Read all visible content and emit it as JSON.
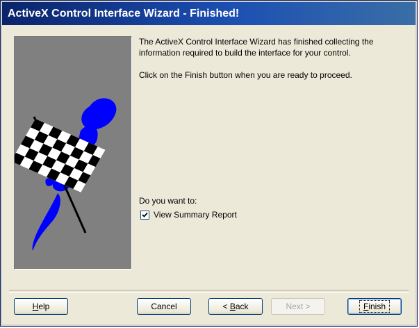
{
  "window": {
    "title": "ActiveX Control Interface Wizard - Finished!"
  },
  "content": {
    "paragraph1": "The ActiveX Control Interface Wizard has finished collecting the information required to build the interface for your control.",
    "paragraph2": "Click on the Finish button when you are ready to proceed.",
    "question": "Do you want to:",
    "view_summary_label": "View Summary Report",
    "view_summary_checked": true
  },
  "buttons": {
    "help": {
      "mnemonic": "H",
      "rest": "elp"
    },
    "cancel": {
      "label": "Cancel"
    },
    "back": {
      "prefix": "< ",
      "mnemonic": "B",
      "rest": "ack"
    },
    "next": {
      "label": "Next >"
    },
    "finish": {
      "mnemonic": "F",
      "rest": "inish"
    }
  },
  "colors": {
    "title_gradient_start": "#0a246a",
    "art_background": "#808080",
    "brush_stroke": "#0000ff",
    "dialog_face": "#ece9d8"
  },
  "icons": {
    "art": "checkered-flag-icon"
  }
}
